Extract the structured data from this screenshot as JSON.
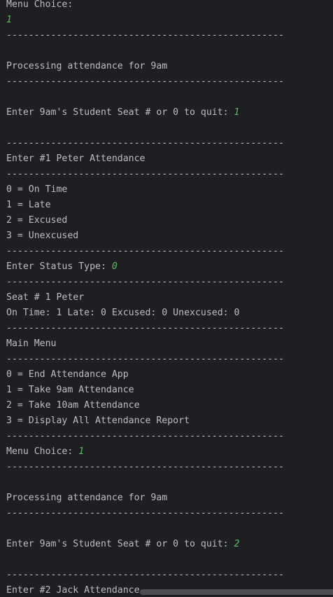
{
  "console": {
    "lines": [
      {
        "text": "Menu Choice:",
        "input": ""
      },
      {
        "text": "",
        "input": "1"
      },
      {
        "text": "--------------------------------------------------",
        "input": ""
      },
      {
        "text": "",
        "input": ""
      },
      {
        "text": "Processing attendance for 9am",
        "input": ""
      },
      {
        "text": "--------------------------------------------------",
        "input": ""
      },
      {
        "text": "",
        "input": ""
      },
      {
        "text": "Enter 9am's Student Seat # or 0 to quit: ",
        "input": "1"
      },
      {
        "text": "",
        "input": ""
      },
      {
        "text": "--------------------------------------------------",
        "input": ""
      },
      {
        "text": "Enter #1 Peter Attendance",
        "input": ""
      },
      {
        "text": "--------------------------------------------------",
        "input": ""
      },
      {
        "text": "0 = On Time",
        "input": ""
      },
      {
        "text": "1 = Late",
        "input": ""
      },
      {
        "text": "2 = Excused",
        "input": ""
      },
      {
        "text": "3 = Unexcused",
        "input": ""
      },
      {
        "text": "--------------------------------------------------",
        "input": ""
      },
      {
        "text": "Enter Status Type: ",
        "input": "0"
      },
      {
        "text": "--------------------------------------------------",
        "input": ""
      },
      {
        "text": "Seat # 1 Peter",
        "input": ""
      },
      {
        "text": "On Time: 1 Late: 0 Excused: 0 Unexcused: 0",
        "input": ""
      },
      {
        "text": "--------------------------------------------------",
        "input": ""
      },
      {
        "text": "Main Menu",
        "input": ""
      },
      {
        "text": "--------------------------------------------------",
        "input": ""
      },
      {
        "text": "0 = End Attendance App",
        "input": ""
      },
      {
        "text": "1 = Take 9am Attendance",
        "input": ""
      },
      {
        "text": "2 = Take 10am Attendance",
        "input": ""
      },
      {
        "text": "3 = Display All Attendance Report",
        "input": ""
      },
      {
        "text": "--------------------------------------------------",
        "input": ""
      },
      {
        "text": "Menu Choice: ",
        "input": "1"
      },
      {
        "text": "--------------------------------------------------",
        "input": ""
      },
      {
        "text": "",
        "input": ""
      },
      {
        "text": "Processing attendance for 9am",
        "input": ""
      },
      {
        "text": "--------------------------------------------------",
        "input": ""
      },
      {
        "text": "",
        "input": ""
      },
      {
        "text": "Enter 9am's Student Seat # or 0 to quit: ",
        "input": "2"
      },
      {
        "text": "",
        "input": ""
      },
      {
        "text": "--------------------------------------------------",
        "input": ""
      },
      {
        "text": "Enter #2 Jack Attendance",
        "input": ""
      }
    ]
  },
  "colors": {
    "background": "#1e1f22",
    "text": "#bcbec4",
    "user_input": "#5fb865",
    "scrollbar": "#4b4d52"
  }
}
